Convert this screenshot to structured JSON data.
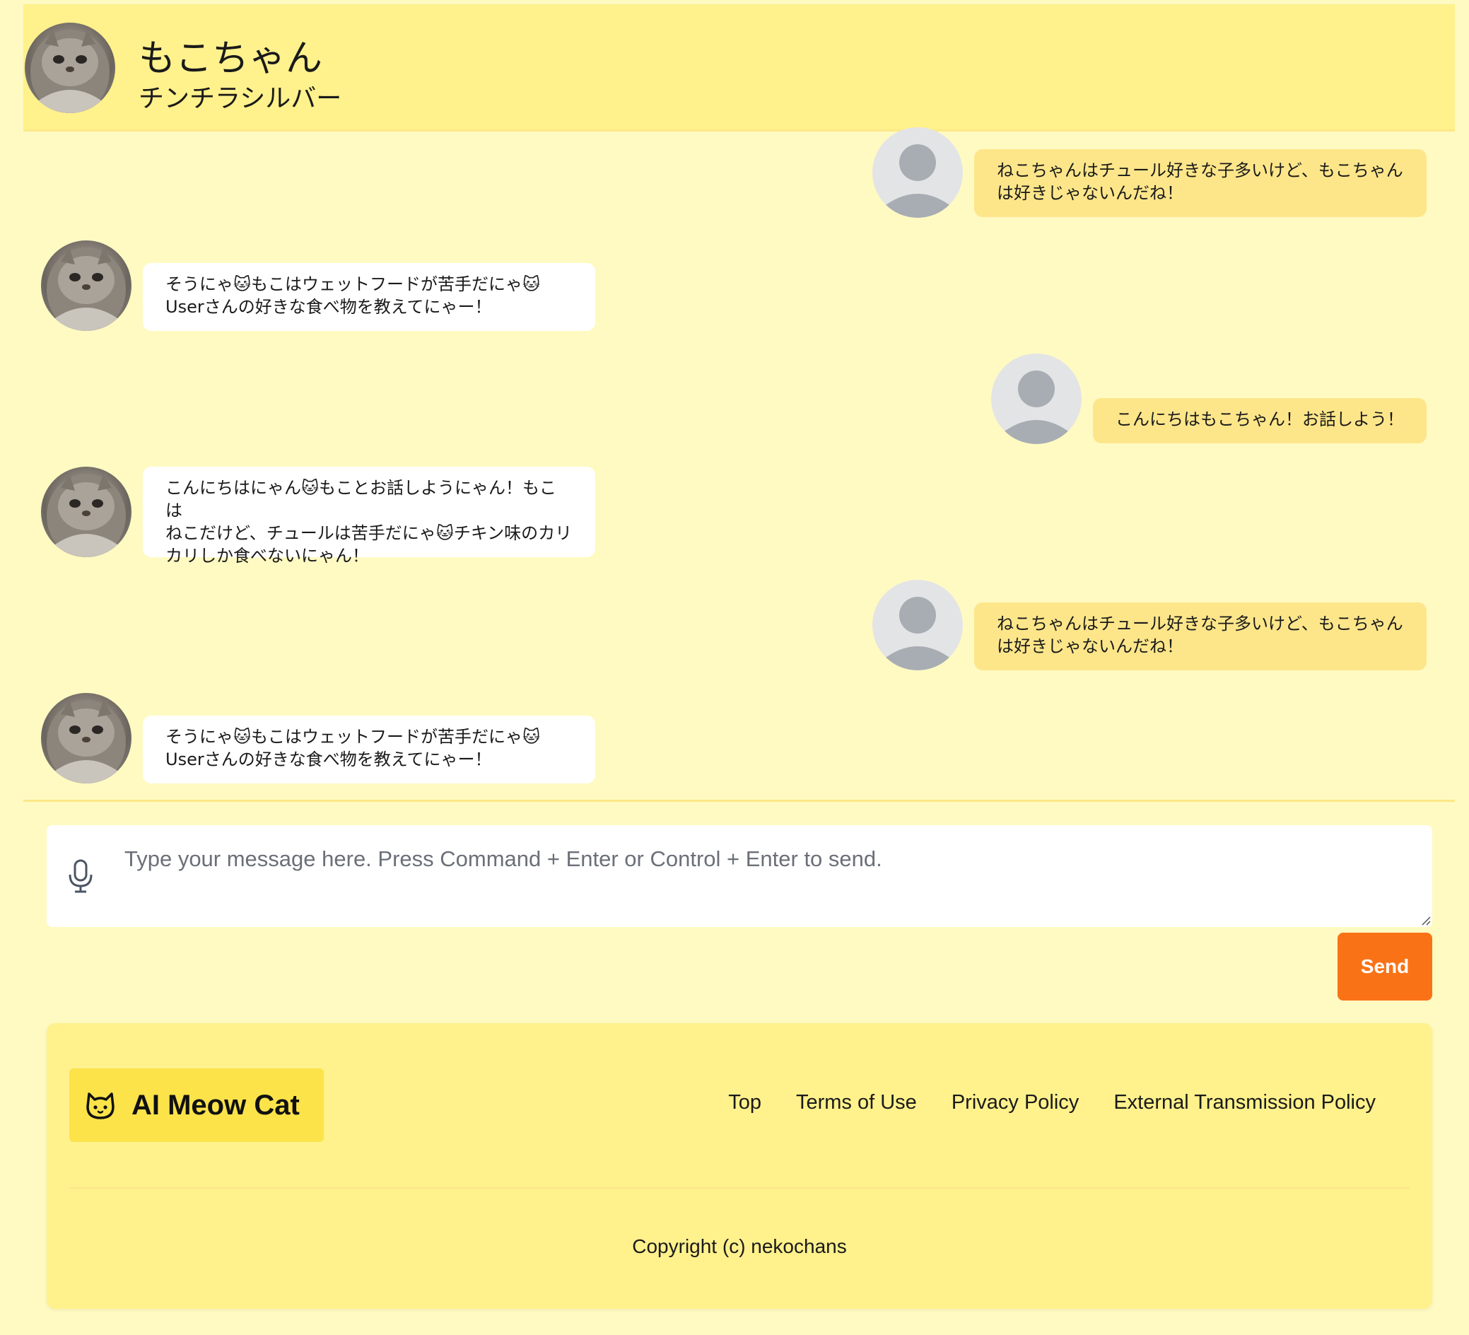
{
  "header": {
    "name": "もこちゃん",
    "breed": "チンチラシルバー"
  },
  "messages": [
    {
      "sender": "user",
      "text": "ねこちゃんはチュール好きな子多いけど、もこちゃん\nは好きじゃないんだね！"
    },
    {
      "sender": "bot",
      "text": "そうにゃ🐱もこはウェットフードが苦手だにゃ🐱\nUserさんの好きな食べ物を教えてにゃー！"
    },
    {
      "sender": "user",
      "text": "こんにちはもこちゃん！お話しよう！"
    },
    {
      "sender": "bot",
      "text": "こんにちはにゃん🐱もことお話しようにゃん！もこは\nねこだけど、チュールは苦手だにゃ🐱チキン味のカリ\nカリしか食べないにゃん！"
    },
    {
      "sender": "user",
      "text": "ねこちゃんはチュール好きな子多いけど、もこちゃん\nは好きじゃないんだね！"
    },
    {
      "sender": "bot",
      "text": "そうにゃ🐱もこはウェットフードが苦手だにゃ🐱\nUserさんの好きな食べ物を教えてにゃー！"
    }
  ],
  "composer": {
    "placeholder": "Type your message here. Press Command + Enter or Control + Enter to send.",
    "value": "",
    "send_label": "Send"
  },
  "footer": {
    "brand": "AI Meow Cat",
    "links": [
      "Top",
      "Terms of Use",
      "Privacy Policy",
      "External Transmission Policy"
    ],
    "copyright": "Copyright (c) nekochans"
  },
  "colors": {
    "background": "#fffac2",
    "header": "#fff18c",
    "user_bubble": "#fde68a",
    "bot_bubble": "#ffffff",
    "send_button": "#f97316",
    "brand_badge": "#fce34a"
  }
}
